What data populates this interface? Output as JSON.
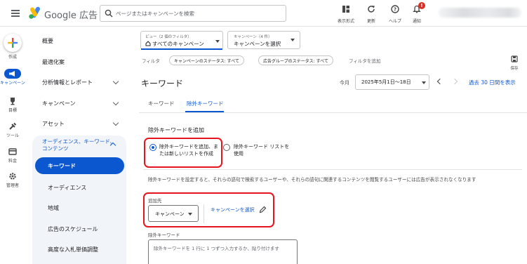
{
  "header": {
    "product_name": "Google 広告",
    "search_placeholder": "ページまたはキャンペーンを検索",
    "actions": [
      {
        "label": "表示形式",
        "icon": "view-format-icon"
      },
      {
        "label": "更新",
        "icon": "refresh-icon"
      },
      {
        "label": "ヘルプ",
        "icon": "help-icon"
      },
      {
        "label": "通知",
        "icon": "bell-icon",
        "badge": "!"
      }
    ]
  },
  "rail": {
    "create": "作成",
    "campaigns": "キャンペーン",
    "goals": "目標",
    "tools": "ツール",
    "billing": "料金",
    "admin": "管理者"
  },
  "nav": {
    "overview": "概要",
    "recommendations": "最適化案",
    "insights": "分析情報とレポート",
    "campaigns": "キャンペーン",
    "assets": "アセット",
    "group_label": "オーディエンス、キーワード、コンテンツ",
    "keywords": "キーワード",
    "audiences": "オーディエンス",
    "locations": "地域",
    "ad_schedule": "広告のスケジュール",
    "bid_adjustments": "高度な入札単価調整"
  },
  "filters": {
    "view_caption": "ビュー（2 個のフィルタ）",
    "view_value": "すべてのキャンペーン",
    "campaign_caption": "キャンペーン（4 件）",
    "campaign_value": "キャンペーンを選択",
    "filter_label": "フィルタ",
    "chips": [
      "キャンペーンのステータス: すべて",
      "広告グループのステータス: すべて"
    ],
    "add_filter": "フィルタを追加",
    "save_label": "保存"
  },
  "page": {
    "title": "キーワード",
    "today_label": "今月",
    "date_range": "2025年5月1日〜18日",
    "compare_label": "過去 30 日間を表示",
    "tabs": [
      "キーワード",
      "除外キーワード"
    ],
    "active_tab": 1
  },
  "form": {
    "section_title": "除外キーワードを追加",
    "option1": "除外キーワードを追加、または新しいリストを作成",
    "option2": "除外キーワード リストを使用",
    "description": "除外キーワードを設定すると、それらの語句で検索するユーザーや、それらの語句に関連するコンテンツを閲覧するユーザーには広告が表示されなくなります",
    "add_to_label": "追加先",
    "add_to_value": "キャンペーン",
    "select_campaign_link": "キャンペーンを選択",
    "negative_keywords_label": "除外キーワード",
    "textarea_placeholder": "除外キーワードを 1 行に 1 つずつ入力するか、貼り付けます"
  },
  "colors": {
    "accent": "#0b57d0",
    "highlight": "#e8141e",
    "nav_group_bg": "#f1f4f8"
  }
}
